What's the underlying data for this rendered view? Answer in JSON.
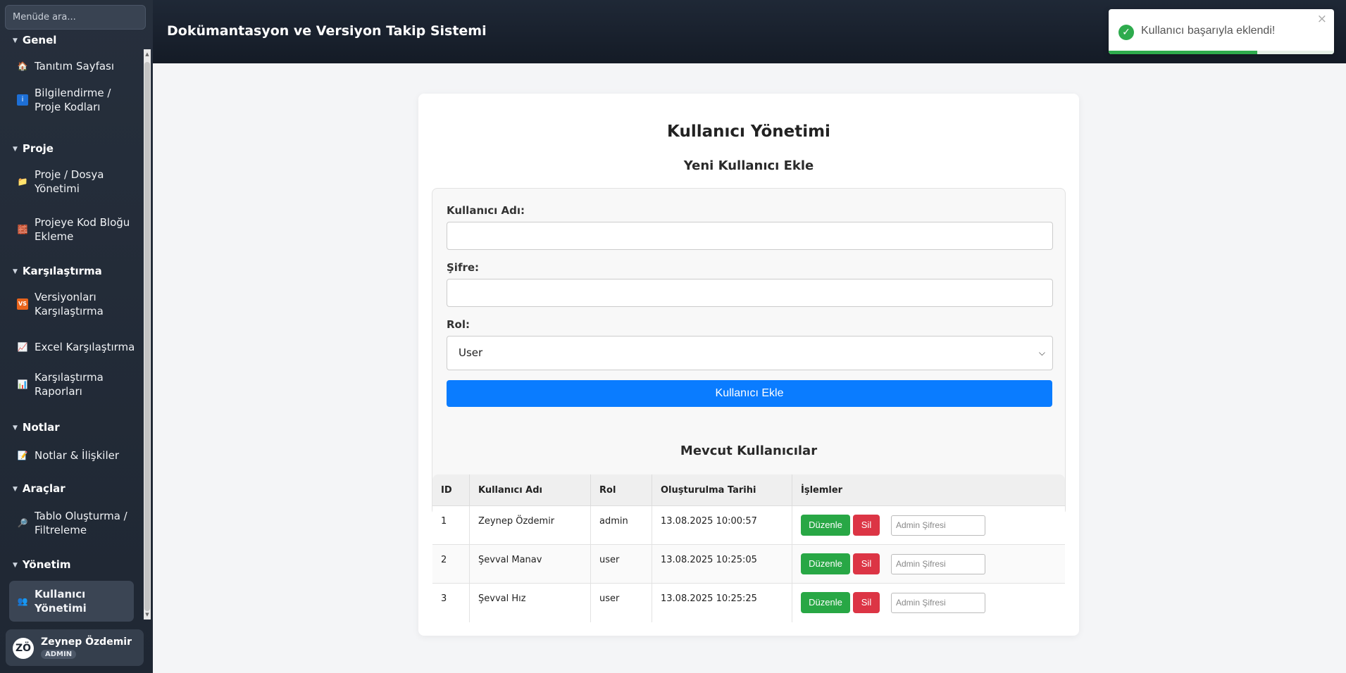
{
  "sidebar": {
    "search_placeholder": "Menüde ara...",
    "sections": {
      "genel": "Genel",
      "proje": "Proje",
      "karsilastirma": "Karşılaştırma",
      "notlar": "Notlar",
      "araclar": "Araçlar",
      "yonetim": "Yönetim"
    },
    "items": {
      "tanitim": "Tanıtım Sayfası",
      "bilgilendirme": "Bilgilendirme / Proje Kodları",
      "proje_dosya": "Proje / Dosya Yönetimi",
      "kod_blogu": "Projeye Kod Bloğu Ekleme",
      "versiyonlar": "Versiyonları Karşılaştırma",
      "excel": "Excel Karşılaştırma",
      "raporlar": "Karşılaştırma Raporları",
      "notlar_iliskiler": "Notlar & İlişkiler",
      "tablo": "Tablo Oluşturma / Filtreleme",
      "kullanici": "Kullanıcı Yönetimi"
    },
    "user": {
      "initials": "ZÖ",
      "name": "Zeynep Özdemir",
      "role": "ADMIN"
    }
  },
  "header": {
    "title": "Dokümantasyon ve Versiyon Takip Sistemi"
  },
  "toast": {
    "message": "Kullanıcı başarıyla eklendi!",
    "close": "×",
    "progress_pct": 66
  },
  "main": {
    "title": "Kullanıcı Yönetimi",
    "form_title": "Yeni Kullanıcı Ekle",
    "username_label": "Kullanıcı Adı:",
    "username_value": "",
    "password_label": "Şifre:",
    "password_value": "",
    "role_label": "Rol:",
    "role_selected": "User",
    "add_button": "Kullanıcı Ekle",
    "list_title": "Mevcut Kullanıcılar"
  },
  "table": {
    "headers": [
      "ID",
      "Kullanıcı Adı",
      "Rol",
      "Oluşturulma Tarihi",
      "İşlemler"
    ],
    "edit_label": "Düzenle",
    "delete_label": "Sil",
    "password_placeholder": "Admin Şifresi",
    "rows": [
      {
        "id": "1",
        "username": "Zeynep Özdemir",
        "role": "admin",
        "created": "13.08.2025 10:00:57"
      },
      {
        "id": "2",
        "username": "Şevval Manav",
        "role": "user",
        "created": "13.08.2025 10:25:05"
      },
      {
        "id": "3",
        "username": "Şevval Hız",
        "role": "user",
        "created": "13.08.2025 10:25:25"
      }
    ]
  }
}
